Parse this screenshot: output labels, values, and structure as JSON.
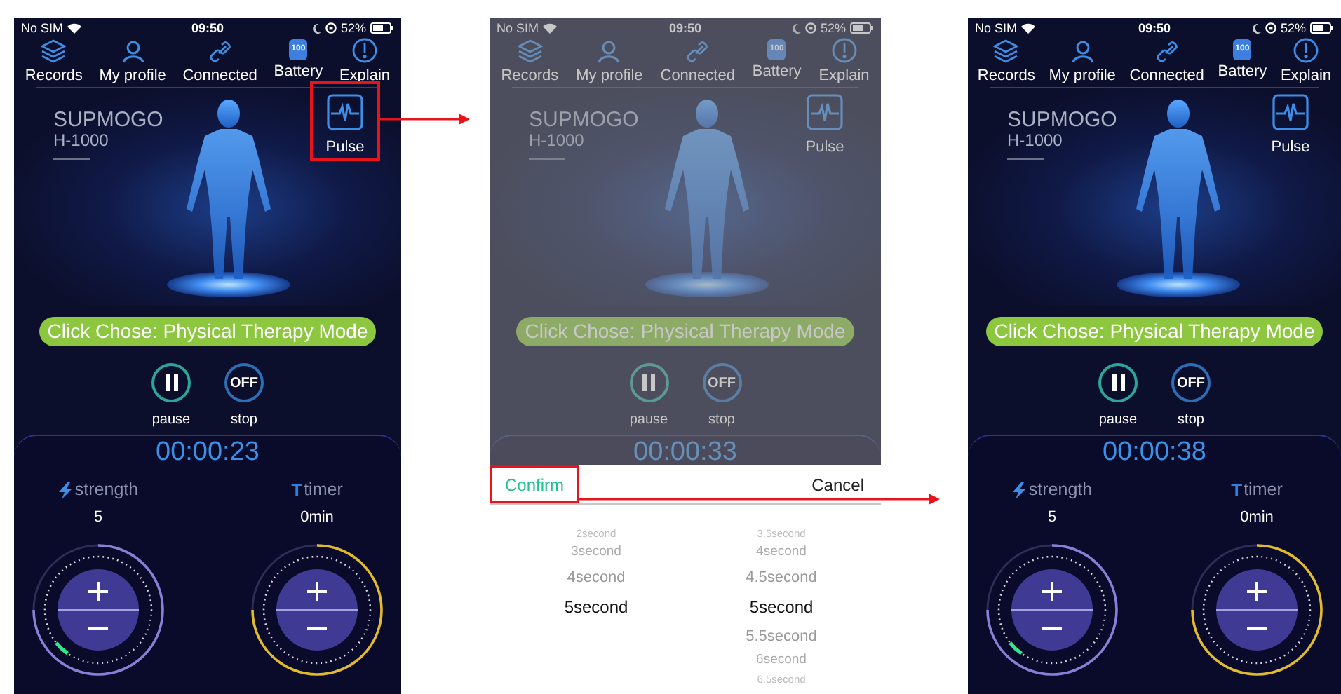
{
  "screens": [
    {
      "dimmed": false,
      "status_bar": {
        "carrier": "No SIM",
        "time": "09:50",
        "battery": "52%"
      },
      "nav": [
        {
          "kind": "records",
          "label": "Records"
        },
        {
          "kind": "profile",
          "label": "My profile"
        },
        {
          "kind": "connected",
          "label": "Connected"
        },
        {
          "kind": "battery",
          "label": "Battery",
          "badge": "100"
        },
        {
          "kind": "explain",
          "label": "Explain"
        }
      ],
      "brand": {
        "name": "SUPMOGO",
        "model": "H-1000"
      },
      "pulse": {
        "label": "Pulse",
        "highlighted": true
      },
      "mode_banner": "Click Chose: Physical Therapy Mode",
      "controls": [
        {
          "kind": "pause",
          "label": "pause"
        },
        {
          "kind": "stop",
          "symbol": "OFF",
          "label": "stop"
        }
      ],
      "elapsed": "00:00:23",
      "dials": [
        {
          "kind": "strength",
          "label": "strength",
          "value": "5",
          "color": "#8a7fd6"
        },
        {
          "kind": "timer",
          "symbol": "T",
          "label": "timer",
          "value": "0min",
          "color": "#e2bb2a"
        }
      ]
    },
    {
      "dimmed": true,
      "status_bar": {
        "carrier": "No SIM",
        "time": "09:50",
        "battery": "52%"
      },
      "nav": [
        {
          "kind": "records",
          "label": "Records"
        },
        {
          "kind": "profile",
          "label": "My profile"
        },
        {
          "kind": "connected",
          "label": "Connected"
        },
        {
          "kind": "battery",
          "label": "Battery",
          "badge": "100"
        },
        {
          "kind": "explain",
          "label": "Explain"
        }
      ],
      "brand": {
        "name": "SUPMOGO",
        "model": "H-1000"
      },
      "pulse": {
        "label": "Pulse",
        "highlighted": false
      },
      "mode_banner": "Click Chose: Physical Therapy Mode",
      "controls": [
        {
          "kind": "pause",
          "label": "pause"
        },
        {
          "kind": "stop",
          "symbol": "OFF",
          "label": "stop"
        }
      ],
      "elapsed": "00:00:33",
      "picker": {
        "confirm": {
          "label": "Confirm",
          "highlighted": true
        },
        "cancel": "Cancel",
        "columns": [
          {
            "items": [
              {
                "label": "2second",
                "selected": false
              },
              {
                "label": "3second",
                "selected": false
              },
              {
                "label": "4second",
                "selected": false
              },
              {
                "label": "5second",
                "selected": true
              }
            ]
          },
          {
            "items": [
              {
                "label": "3.5second",
                "selected": false
              },
              {
                "label": "4second",
                "selected": false
              },
              {
                "label": "4.5second",
                "selected": false
              },
              {
                "label": "5second",
                "selected": true
              },
              {
                "label": "5.5second",
                "selected": false
              },
              {
                "label": "6second",
                "selected": false
              },
              {
                "label": "6.5second",
                "selected": false
              }
            ]
          }
        ]
      }
    },
    {
      "dimmed": false,
      "status_bar": {
        "carrier": "No SIM",
        "time": "09:50",
        "battery": "52%"
      },
      "nav": [
        {
          "kind": "records",
          "label": "Records"
        },
        {
          "kind": "profile",
          "label": "My profile"
        },
        {
          "kind": "connected",
          "label": "Connected"
        },
        {
          "kind": "battery",
          "label": "Battery",
          "badge": "100"
        },
        {
          "kind": "explain",
          "label": "Explain"
        }
      ],
      "brand": {
        "name": "SUPMOGO",
        "model": "H-1000"
      },
      "pulse": {
        "label": "Pulse",
        "highlighted": false
      },
      "mode_banner": "Click Chose: Physical Therapy Mode",
      "controls": [
        {
          "kind": "pause",
          "label": "pause"
        },
        {
          "kind": "stop",
          "symbol": "OFF",
          "label": "stop"
        }
      ],
      "elapsed": "00:00:38",
      "dials": [
        {
          "kind": "strength",
          "label": "strength",
          "value": "5",
          "color": "#8a7fd6"
        },
        {
          "kind": "timer",
          "symbol": "T",
          "label": "timer",
          "value": "0min",
          "color": "#e2bb2a"
        }
      ]
    }
  ]
}
